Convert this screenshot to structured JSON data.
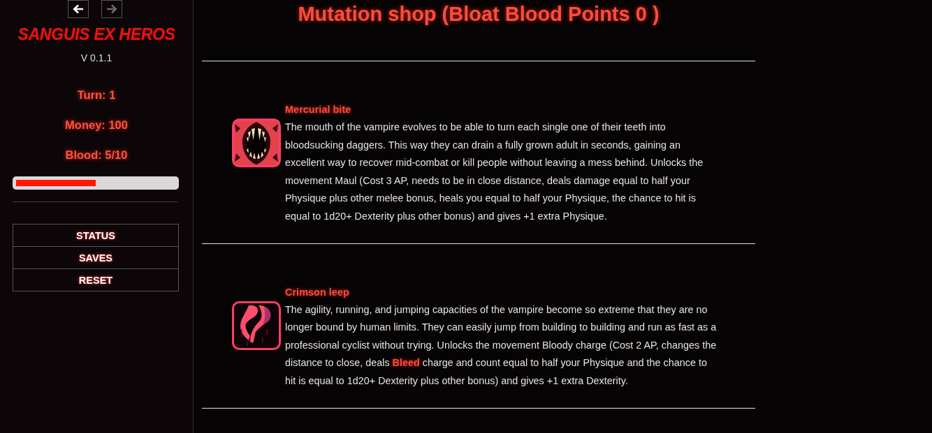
{
  "sidebar": {
    "nav_buttons": [
      {
        "kind": "back",
        "disabled": false
      },
      {
        "kind": "forward",
        "disabled": true
      }
    ],
    "title": "SANGUIS EX HEROS",
    "version": "V 0.1.1",
    "stats": [
      "Turn: 1",
      "Money: 100",
      "Blood: 5/10"
    ],
    "blood_bar": {
      "level": 0.5
    },
    "menu": [
      "STATUS",
      "SAVES",
      "RESET"
    ]
  },
  "main": {
    "heading": "Mutation shop (Bloat Blood Points 0 )",
    "mutations": [
      {
        "name": "Mercurial bite",
        "kind": "fangs",
        "description": "The mouth of the vampire evolves to be able to turn each single one of their teeth into bloodsucking daggers. This way they can drain a fully grown adult in seconds, gaining an excellent way to recover mid-combat or kill people without leaving a mess behind. Unlocks the movement Maul (Cost 3 AP, needs to be in close distance, deals damage equal to half your Physique plus other melee bonus, heals you equal to half your Physique, the chance to hit is equal to 1d20+ Dexterity plus other bonus) and gives +1 extra Physique."
      },
      {
        "name": "Crimson leep",
        "kind": "legs",
        "description": "The agility, running, and jumping capacities of the vampire become so extreme that they are no longer bound by human limits. They can easily jump from building to building and run as fast as a professional cyclist without trying. Unlocks the movement Bloody charge (Cost 2 AP, changes the distance to close, deals **Bleed** charge and count equal to half your Physique and the chance to hit is equal to 1d20+ Dexterity plus other bonus) and gives +1 extra Dexterity."
      }
    ]
  }
}
